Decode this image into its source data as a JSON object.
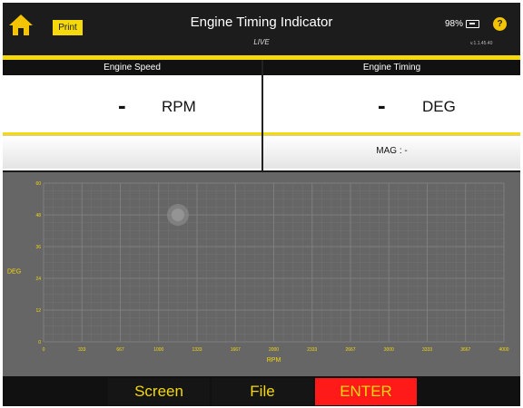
{
  "header": {
    "home_icon": "home-icon",
    "print_label": "Print",
    "title": "Engine Timing Indicator",
    "mode": "LIVE",
    "battery_percent": "98%",
    "battery_icon": "battery-icon",
    "help_label": "?",
    "version": "v.1.1.45.40"
  },
  "engine_speed": {
    "label": "Engine Speed",
    "value": "-",
    "unit": "RPM"
  },
  "engine_timing": {
    "label": "Engine Timing",
    "value": "-",
    "unit": "DEG",
    "mag_label": "MAG : -"
  },
  "chart_data": {
    "type": "scatter",
    "xlabel": "RPM",
    "ylabel": "DEG",
    "xlim": [
      0,
      4000
    ],
    "ylim": [
      0,
      60
    ],
    "x_ticks": [
      "0",
      "333",
      "667",
      "1000",
      "1333",
      "1667",
      "2000",
      "2333",
      "2667",
      "3000",
      "3333",
      "3667",
      "4000"
    ],
    "y_ticks": [
      "0",
      "12",
      "24",
      "36",
      "48",
      "60"
    ],
    "grid": true,
    "series": [],
    "marker": {
      "x": 1167,
      "y": 48
    }
  },
  "colors": {
    "accent": "#f5d90a",
    "enter_bg": "#ff1a1a",
    "chart_bg": "#666666"
  },
  "bottom": {
    "screen_label": "Screen",
    "file_label": "File",
    "enter_label": "ENTER"
  }
}
